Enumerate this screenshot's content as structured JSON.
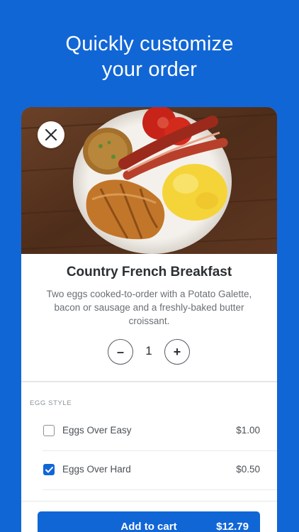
{
  "headline": {
    "line1": "Quickly customize",
    "line2": "your order"
  },
  "item": {
    "title": "Country French Breakfast",
    "description": "Two eggs cooked-to-order with a Potato Galette, bacon or sausage and a freshly-baked butter croissant.",
    "image": "breakfast-plate-photo"
  },
  "quantity": {
    "value": "1",
    "minus_label": "–",
    "plus_label": "+"
  },
  "options": {
    "section_label": "EGG STYLE",
    "items": [
      {
        "label": "Eggs Over Easy",
        "price": "$1.00",
        "checked": false
      },
      {
        "label": "Eggs Over Hard",
        "price": "$0.50",
        "checked": true
      }
    ]
  },
  "cart": {
    "label": "Add to cart",
    "total": "$12.79"
  },
  "colors": {
    "background": "#1166d6",
    "accent": "#1166d6",
    "card": "#ffffff"
  },
  "icons": {
    "close": "close-icon",
    "check": "checkmark-icon"
  }
}
